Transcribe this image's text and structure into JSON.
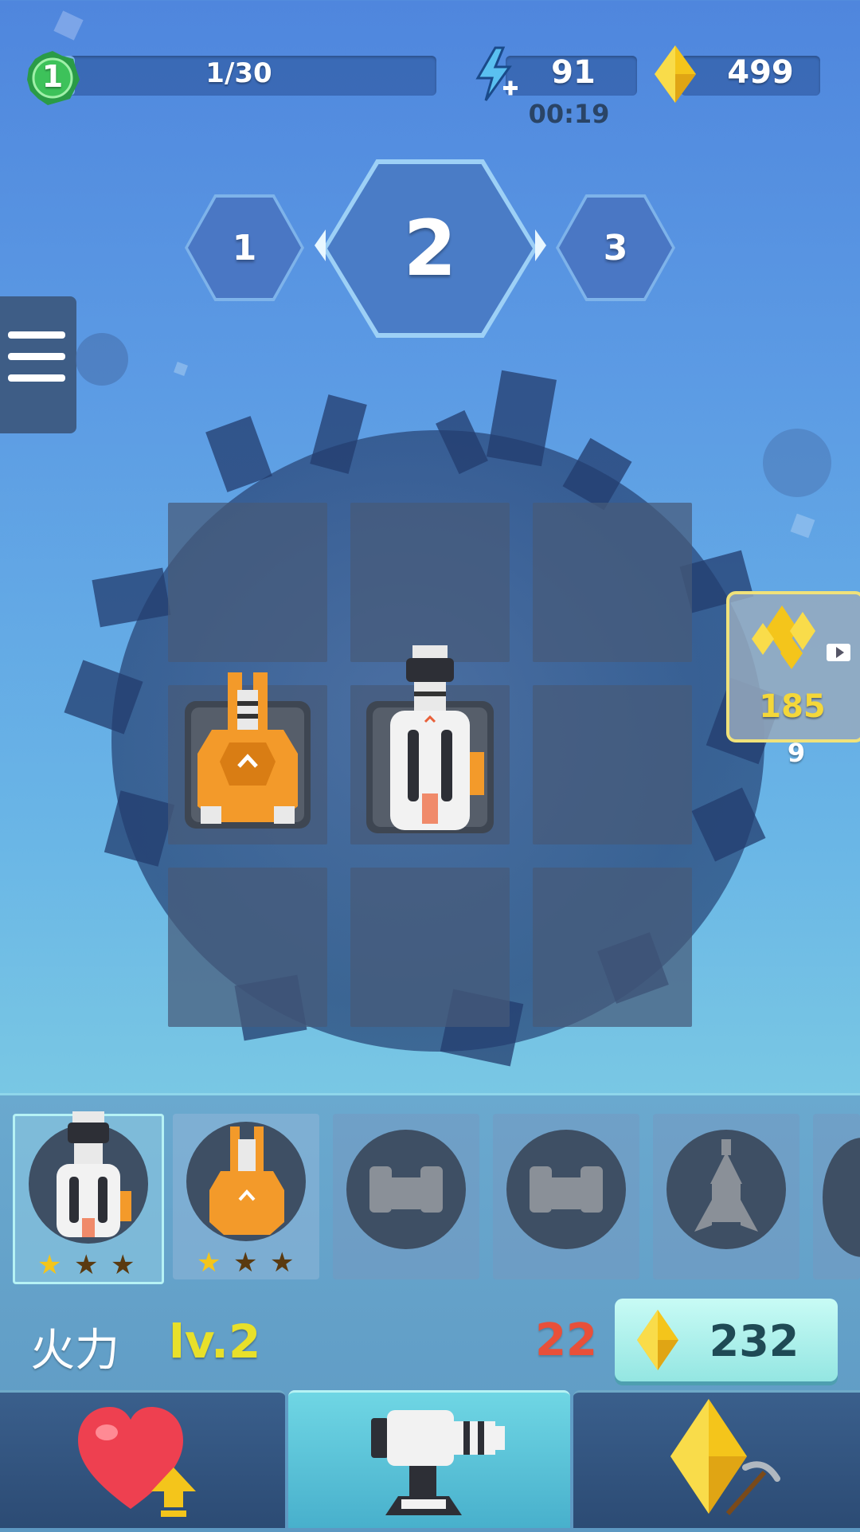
{
  "hud": {
    "level": "1",
    "progress_text": "1/30",
    "progress_fraction": 0.0333,
    "energy": "91",
    "energy_timer": "00:19",
    "gems": "499"
  },
  "stages": {
    "prev": "1",
    "current": "2",
    "next": "3"
  },
  "reward": {
    "amount": "185",
    "count": "9"
  },
  "grid": {
    "rows": 3,
    "cols": 3,
    "occupied": [
      {
        "row": 2,
        "col": 1,
        "turret": "orange-turret"
      },
      {
        "row": 2,
        "col": 2,
        "turret": "white-turret"
      }
    ]
  },
  "inventory": {
    "slots": [
      {
        "name": "white-turret",
        "unlocked": true,
        "selected": true,
        "stars_filled": 1,
        "stars_total": 3
      },
      {
        "name": "orange-turret",
        "unlocked": true,
        "selected": false,
        "stars_filled": 1,
        "stars_total": 3
      },
      {
        "name": "locked-turret-a",
        "unlocked": false
      },
      {
        "name": "locked-turret-b",
        "unlocked": false
      },
      {
        "name": "locked-rocket",
        "unlocked": false
      },
      {
        "name": "locked-partial",
        "unlocked": false
      }
    ]
  },
  "upgrade": {
    "label": "火力",
    "level": "lv.2",
    "value": "22",
    "cost": "232"
  },
  "tabs": [
    {
      "name": "health-upgrade-tab",
      "active": false
    },
    {
      "name": "turret-tab",
      "active": true
    },
    {
      "name": "mining-tab",
      "active": false
    }
  ],
  "colors": {
    "gold": "#f4c51b",
    "level_yellow": "#e8e02a",
    "value_red": "#e8503a",
    "teal_button": "#a7f1ec",
    "green_badge": "#3dc25a"
  }
}
